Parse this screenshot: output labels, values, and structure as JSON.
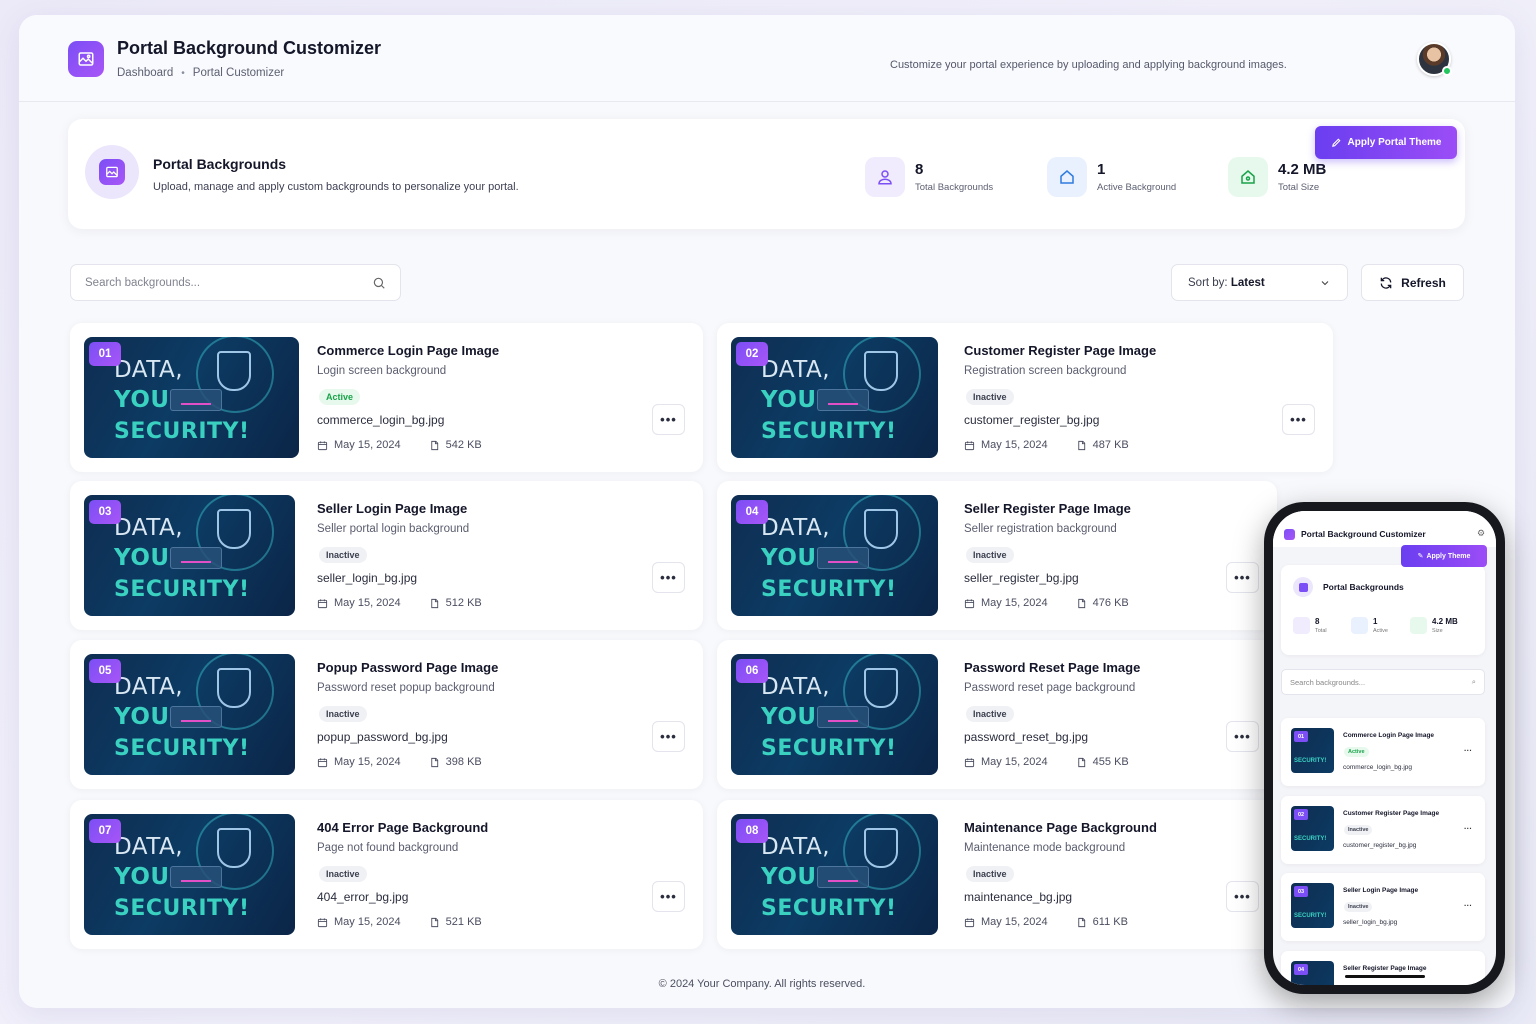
{
  "header": {
    "title": "Portal Background Customizer",
    "breadcrumb": [
      "Dashboard",
      "Portal Customizer"
    ],
    "description": "Customize your portal experience by uploading and applying background images."
  },
  "summary": {
    "title": "Portal Backgrounds",
    "subtitle": "Upload, manage and apply custom backgrounds to personalize your portal.",
    "stats": [
      {
        "value": "8",
        "label": "Total Backgrounds"
      },
      {
        "value": "1",
        "label": "Active Background"
      },
      {
        "value": "4.2 MB",
        "label": "Total Size"
      }
    ],
    "apply_button": "Apply Portal Theme"
  },
  "toolbar": {
    "search_placeholder": "Search backgrounds...",
    "sort_label": "Sort by:",
    "sort_value": "Latest",
    "refresh_label": "Refresh"
  },
  "thumbnail_text": [
    "DATA,",
    "YOU",
    "SECURITY!"
  ],
  "cards": [
    {
      "num": "01",
      "title": "Commerce Login Page Image",
      "desc": "Login screen background",
      "status": "Active",
      "file": "commerce_login_bg.jpg",
      "date": "May 15, 2024",
      "size": "542 KB"
    },
    {
      "num": "02",
      "title": "Customer Register Page Image",
      "desc": "Registration screen background",
      "status": "Inactive",
      "file": "customer_register_bg.jpg",
      "date": "May 15, 2024",
      "size": "487 KB"
    },
    {
      "num": "03",
      "title": "Seller Login Page Image",
      "desc": "Seller portal login background",
      "status": "Inactive",
      "file": "seller_login_bg.jpg",
      "date": "May 15, 2024",
      "size": "512 KB"
    },
    {
      "num": "04",
      "title": "Seller Register Page Image",
      "desc": "Seller registration background",
      "status": "Inactive",
      "file": "seller_register_bg.jpg",
      "date": "May 15, 2024",
      "size": "476 KB"
    },
    {
      "num": "05",
      "title": "Popup Password Page Image",
      "desc": "Password reset popup background",
      "status": "Inactive",
      "file": "popup_password_bg.jpg",
      "date": "May 15, 2024",
      "size": "398 KB"
    },
    {
      "num": "06",
      "title": "Password Reset Page Image",
      "desc": "Password reset page background",
      "status": "Inactive",
      "file": "password_reset_bg.jpg",
      "date": "May 15, 2024",
      "size": "455 KB"
    },
    {
      "num": "07",
      "title": "404 Error Page Background",
      "desc": "Page not found background",
      "status": "Inactive",
      "file": "404_error_bg.jpg",
      "date": "May 15, 2024",
      "size": "521 KB"
    },
    {
      "num": "08",
      "title": "Maintenance Page Background",
      "desc": "Maintenance mode background",
      "status": "Inactive",
      "file": "maintenance_bg.jpg",
      "date": "May 15, 2024",
      "size": "611 KB"
    }
  ],
  "footer": "© 2024 Your Company. All rights reserved.",
  "mobile": {
    "app_title": "Portal Background Customizer",
    "apply_button": "Apply Theme",
    "summary_title": "Portal Backgrounds",
    "stats": [
      {
        "value": "8",
        "label": "Total"
      },
      {
        "value": "1",
        "label": "Active"
      },
      {
        "value": "4.2 MB",
        "label": "Size"
      }
    ],
    "search_placeholder": "Search backgrounds...",
    "items": [
      {
        "num": "01",
        "title": "Commerce Login Page Image",
        "status": "Active",
        "file": "commerce_login_bg.jpg"
      },
      {
        "num": "02",
        "title": "Customer Register Page Image",
        "status": "Inactive",
        "file": "customer_register_bg.jpg"
      },
      {
        "num": "03",
        "title": "Seller Login Page Image",
        "status": "Inactive",
        "file": "seller_login_bg.jpg"
      },
      {
        "num": "04",
        "title": "Seller Register Page Image",
        "status": "",
        "file": ""
      }
    ]
  },
  "colors": {
    "accent": "#7b4ff5",
    "accent_end": "#a855f7",
    "active_green": "#18a34a",
    "thumb_teal": "#3ad1c1"
  }
}
